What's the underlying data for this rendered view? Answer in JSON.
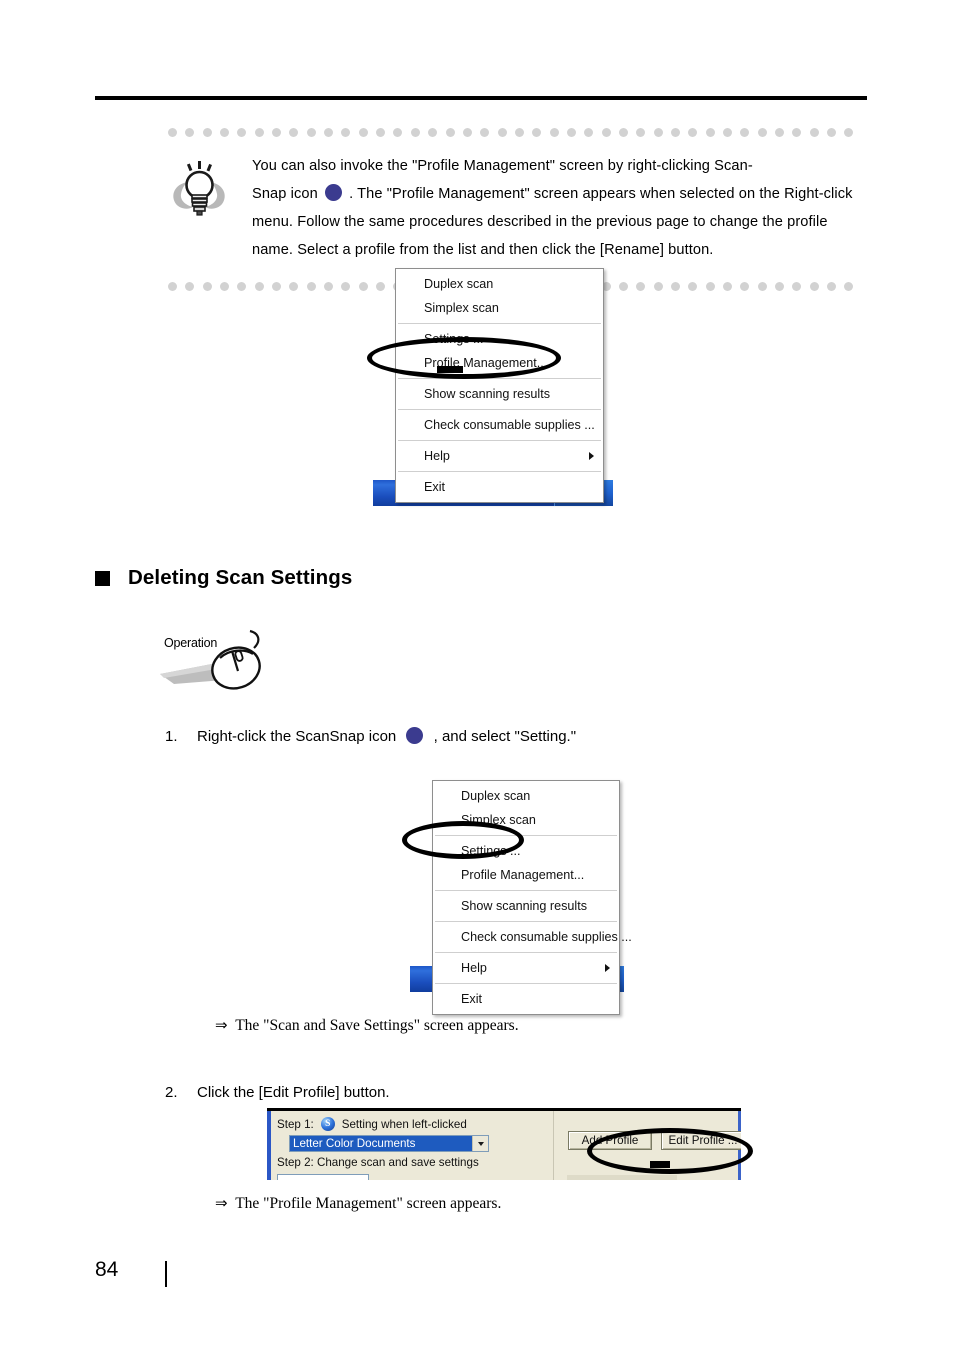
{
  "page": {
    "number": "84"
  },
  "tip": {
    "icon": "lightbulb-icon",
    "text_part1": "You can also invoke the \"Profile Management\" screen by right-clicking Scan-",
    "text_part2": "Snap icon",
    "text_part3": ". The \"Profile Management\" screen appears when selected on the Right-click menu. Follow the same procedures described in the previous page to change the profile name. Select a profile from the list and then click the [Rename] button."
  },
  "context_menu_1": {
    "items": [
      {
        "label": "Duplex scan",
        "has_submenu": false,
        "separator_after": false
      },
      {
        "label": "Simplex scan",
        "has_submenu": false,
        "separator_after": true
      },
      {
        "label": "Settings ...",
        "has_submenu": false,
        "separator_after": false
      },
      {
        "label": "Profile Management...",
        "has_submenu": false,
        "separator_after": true
      },
      {
        "label": "Show scanning results",
        "has_submenu": false,
        "separator_after": true
      },
      {
        "label": "Check consumable supplies ...",
        "has_submenu": false,
        "separator_after": true
      },
      {
        "label": "Help",
        "has_submenu": true,
        "separator_after": true
      },
      {
        "label": "Exit",
        "has_submenu": false,
        "separator_after": false
      }
    ],
    "highlighted_item": "Profile Management...",
    "tray": {
      "chevron": "‹",
      "icon_label": "S"
    }
  },
  "context_menu_2": {
    "items": [
      {
        "label": "Duplex scan",
        "has_submenu": false,
        "separator_after": false
      },
      {
        "label": "Simplex scan",
        "has_submenu": false,
        "separator_after": true
      },
      {
        "label": "Settings ...",
        "has_submenu": false,
        "separator_after": false
      },
      {
        "label": "Profile Management...",
        "has_submenu": false,
        "separator_after": true
      },
      {
        "label": "Show scanning results",
        "has_submenu": false,
        "separator_after": true
      },
      {
        "label": "Check consumable supplies ...",
        "has_submenu": false,
        "separator_after": true
      },
      {
        "label": "Help",
        "has_submenu": true,
        "separator_after": true
      },
      {
        "label": "Exit",
        "has_submenu": false,
        "separator_after": false
      }
    ],
    "highlighted_item": "Settings ...",
    "tray": {
      "chevron": "‹",
      "icon_label": "S"
    }
  },
  "section": {
    "bullet": "square-bullet",
    "title": "Deleting Scan Settings"
  },
  "operation_badge": {
    "label": "Operation",
    "icon": "computer-mouse-icon"
  },
  "steps": [
    {
      "number": "1.",
      "text_part1": "Right-click the ScanSnap icon",
      "text_part2": ", and select \"Setting.\"",
      "result_arrow": "⇒",
      "result": "The \"Scan and Save Settings\" screen appears."
    },
    {
      "number": "2.",
      "text_part1": "Click the [Edit Profile] button.",
      "text_part2": "",
      "result_arrow": "⇒",
      "result": "The \"Profile Management\" screen appears."
    }
  ],
  "settings_dialog": {
    "step1_label": "Step 1:",
    "step1_icon": "scansnap-s-icon",
    "step1_icon_label": "S",
    "step1_text": "Setting when left-clicked",
    "profile_combo": {
      "value": "Letter Color Documents",
      "dropdown_icon": "chevron-down-icon"
    },
    "step2_text": "Step 2: Change scan and save settings",
    "buttons": [
      {
        "label": "Add Profile",
        "highlighted": false
      },
      {
        "label": "Edit Profile ...",
        "highlighted": true
      }
    ]
  },
  "colors": {
    "scansnap_icon": "#3b3b8f",
    "selection_blue": "#1e5bbf",
    "taskbar_blue": "#1e56c8",
    "dialog_bg": "#ece9d8",
    "dot_gray": "#d2d2d2",
    "annotation": "#000000"
  }
}
